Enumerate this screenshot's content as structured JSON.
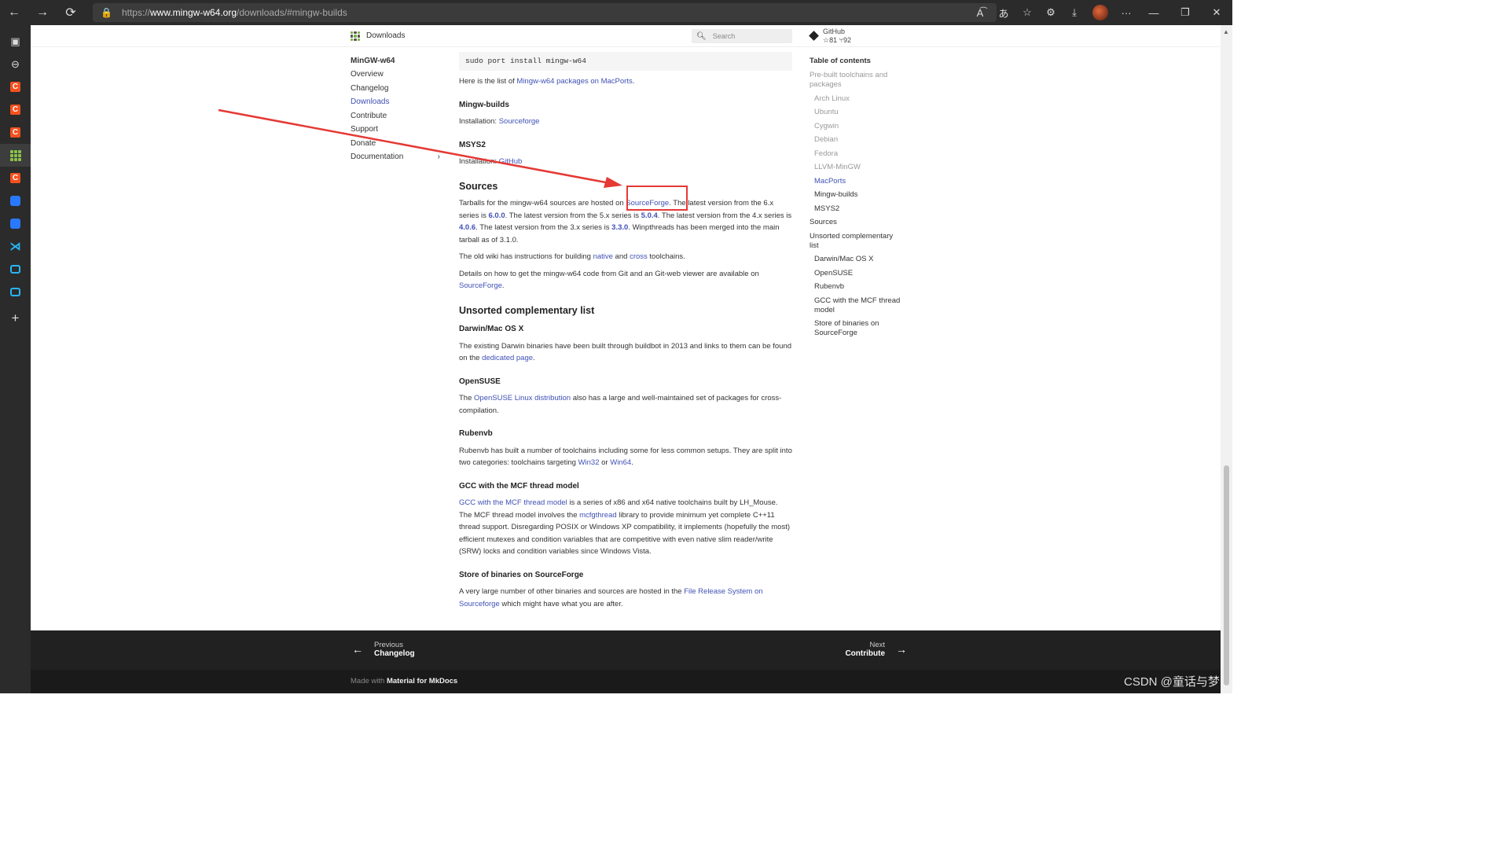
{
  "browser": {
    "url_scheme": "https://",
    "url_host": "www.mingw-w64.org",
    "url_path": "/downloads/#mingw-builds",
    "icons": [
      "back-icon",
      "forward-icon",
      "refresh-icon",
      "lock-icon",
      "read-aloud-icon",
      "translate-icon",
      "favorite-icon",
      "extensions-icon",
      "download-icon",
      "more-icon"
    ]
  },
  "header": {
    "site_title": "Downloads",
    "search_placeholder": "Search",
    "github_label": "GitHub",
    "github_stars": "☆81",
    "github_forks": "⑂92"
  },
  "nav": {
    "title": "MinGW-w64",
    "items": [
      "Overview",
      "Changelog",
      "Downloads",
      "Contribute",
      "Support",
      "Donate"
    ],
    "documentation": "Documentation",
    "doc_chevron": "›"
  },
  "content": {
    "code": "sudo port install mingw-w64",
    "macports_pre": "Here is the list of ",
    "macports_link": "Mingw-w64 packages on MacPorts",
    "macports_post": ".",
    "mingw_builds_heading": "Mingw-builds",
    "install_label": "Installation: ",
    "sourceforge_link": "Sourceforge",
    "msys2_heading": "MSYS2",
    "github_link": "GitHub",
    "sources_heading": "Sources",
    "sources_p1a": "Tarballs for the mingw-w64 sources are hosted on ",
    "sources_sf": "SourceForge",
    "sources_p1b": ". The latest version from the 6.x series is ",
    "v6": "6.0.0",
    "sources_p1c": ". The latest version from the 5.x series is ",
    "v5": "5.0.4",
    "sources_p1d": ". The latest version from the 4.x series is ",
    "v4": "4.0.6",
    "sources_p1e": ". The latest version from the 3.x series is ",
    "v3": "3.3.0",
    "sources_p1f": ". Winpthreads has been merged into the main tarball as of 3.1.0.",
    "wiki_a": "The old wiki has instructions for building ",
    "wiki_native": "native",
    "wiki_and": " and ",
    "wiki_cross": "cross",
    "wiki_b": " toolchains.",
    "git_a": "Details on how to get the mingw-w64 code from Git and an Git-web viewer are available on ",
    "git_sf": "SourceForge",
    "git_b": ".",
    "unsorted_heading": "Unsorted complementary list",
    "darwin_heading": "Darwin/Mac OS X",
    "darwin_a": "The existing Darwin binaries have been built through buildbot in 2013 and links to them can be found on the ",
    "darwin_link": "dedicated page",
    "darwin_b": ".",
    "opensuse_heading": "OpenSUSE",
    "opensuse_a": "The ",
    "opensuse_link": "OpenSUSE Linux distribution",
    "opensuse_b": " also has a large and well-maintained set of packages for cross-compilation.",
    "rubenvb_heading": "Rubenvb",
    "rubenvb_a": "Rubenvb has built a number of toolchains including some for less common setups. They are split into two categories: toolchains targeting ",
    "rubenvb_win32": "Win32",
    "rubenvb_or": " or ",
    "rubenvb_win64": "Win64",
    "rubenvb_b": ".",
    "mcf_heading": "GCC with the MCF thread model",
    "mcf_link": "GCC with the MCF thread model",
    "mcf_a": " is a series of x86 and x64 native toolchains built by LH_Mouse. The MCF thread model involves the ",
    "mcf_lib": "mcfgthread",
    "mcf_b": " library to provide minimum yet complete C++11 thread support. Disregarding POSIX or Windows XP compatibility, it implements (hopefully the most) efficient mutexes and condition variables that are competitive with even native slim reader/write (SRW) locks and condition variables since Windows Vista.",
    "store_heading": "Store of binaries on SourceForge",
    "store_a": "A very large number of other binaries and sources are hosted in the ",
    "store_link": "File Release System on Sourceforge",
    "store_b": " which might have what you are after."
  },
  "toc": {
    "title": "Table of contents",
    "items": [
      {
        "label": "Pre-built toolchains and packages",
        "dim": true,
        "sub": false
      },
      {
        "label": "Arch Linux",
        "dim": true,
        "sub": true
      },
      {
        "label": "Ubuntu",
        "dim": true,
        "sub": true
      },
      {
        "label": "Cygwin",
        "dim": true,
        "sub": true
      },
      {
        "label": "Debian",
        "dim": true,
        "sub": true
      },
      {
        "label": "Fedora",
        "dim": true,
        "sub": true
      },
      {
        "label": "LLVM-MinGW",
        "dim": true,
        "sub": true
      },
      {
        "label": "MacPorts",
        "active": true,
        "sub": true
      },
      {
        "label": "Mingw-builds",
        "sub": true
      },
      {
        "label": "MSYS2",
        "sub": true
      },
      {
        "label": "Sources",
        "sub": false
      },
      {
        "label": "Unsorted complementary list",
        "sub": false
      },
      {
        "label": "Darwin/Mac OS X",
        "sub": true
      },
      {
        "label": "OpenSUSE",
        "sub": true
      },
      {
        "label": "Rubenvb",
        "sub": true
      },
      {
        "label": "GCC with the MCF thread model",
        "sub": true
      },
      {
        "label": "Store of binaries on SourceForge",
        "sub": true
      }
    ]
  },
  "footer": {
    "prev_small": "Previous",
    "prev_title": "Changelog",
    "next_small": "Next",
    "next_title": "Contribute",
    "made_with": "Made with ",
    "made_with_link": "Material for MkDocs"
  },
  "watermark": "CSDN @童话与梦",
  "colors": {
    "accent": "#3f51b5",
    "annotation": "#e53935",
    "footer": "#212121"
  }
}
